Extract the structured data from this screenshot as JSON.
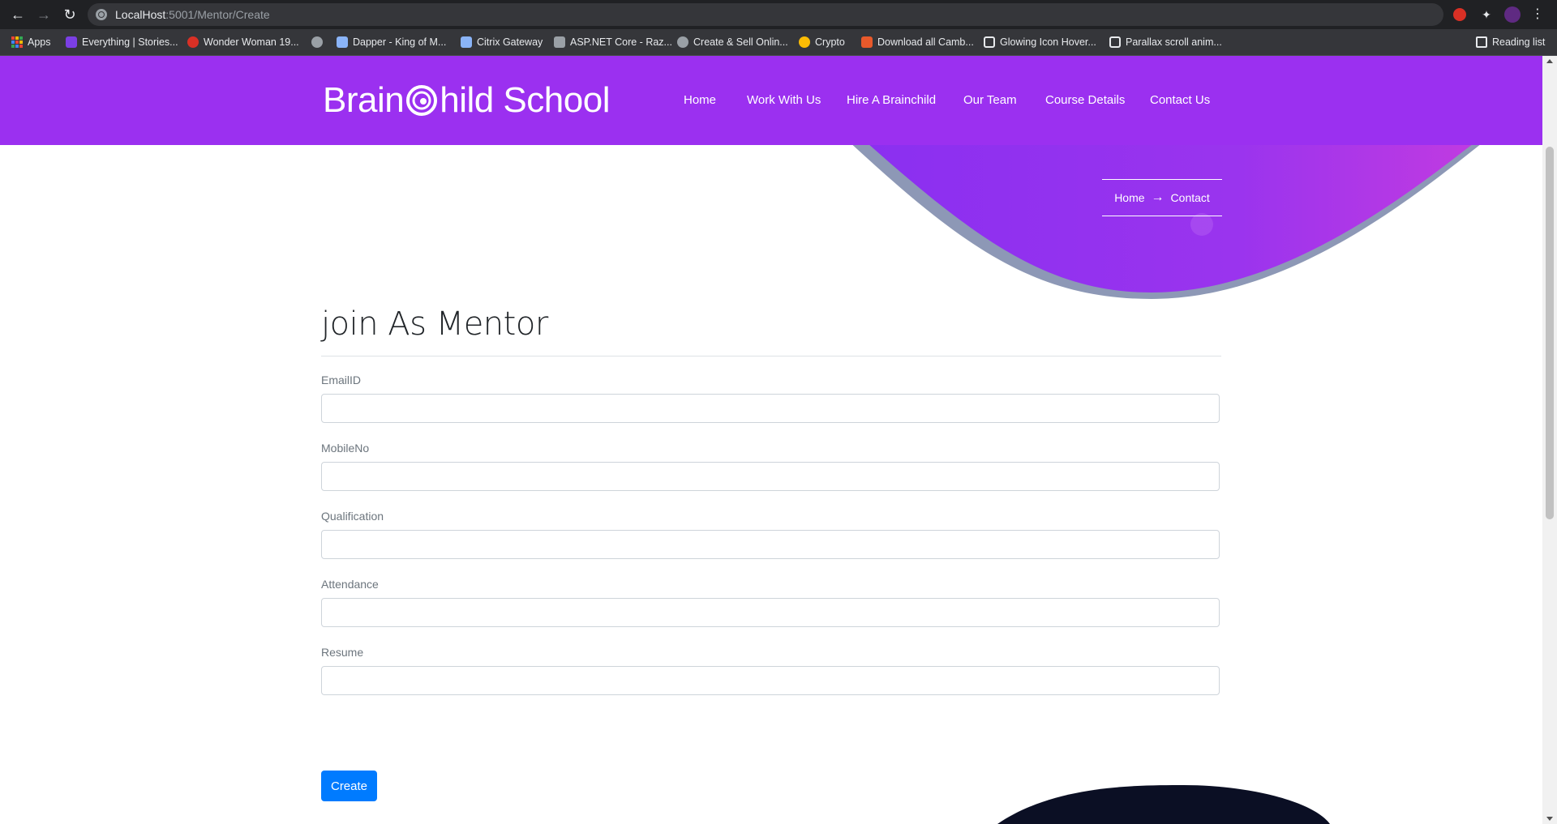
{
  "browser": {
    "url_host": "LocalHost",
    "url_rest": ":5001/Mentor/Create",
    "bookmarks": [
      {
        "label": "Apps",
        "icon": "apps-grid-icon",
        "color": "#4285f4"
      },
      {
        "label": "Everything | Stories...",
        "icon": "stories-icon",
        "color": "#7b3fe4"
      },
      {
        "label": "Wonder Woman 19...",
        "icon": "wonder-woman-icon",
        "color": "#d93025"
      },
      {
        "label": "",
        "icon": "globe-icon",
        "color": "#9aa0a6"
      },
      {
        "label": "Dapper - King of M...",
        "icon": "dapper-icon",
        "color": "#8ab4f8"
      },
      {
        "label": "Citrix Gateway",
        "icon": "citrix-icon",
        "color": "#8ab4f8"
      },
      {
        "label": "ASP.NET Core - Raz...",
        "icon": "aspnet-icon",
        "color": "#9aa0a6"
      },
      {
        "label": "Create & Sell Onlin...",
        "icon": "globe-icon",
        "color": "#9aa0a6"
      },
      {
        "label": "Crypto",
        "icon": "crypto-icon",
        "color": "#fbbc04"
      },
      {
        "label": "Download all Camb...",
        "icon": "download-icon",
        "color": "#e8592b"
      },
      {
        "label": "Glowing Icon Hover...",
        "icon": "codepen-icon",
        "color": "#e8eaed"
      },
      {
        "label": "Parallax scroll anim...",
        "icon": "codepen-icon",
        "color": "#e8eaed"
      }
    ],
    "reading_list": "Reading list"
  },
  "site": {
    "logo_text_1": "Brain",
    "logo_text_2": "hild School",
    "nav": [
      "Home",
      "Work With Us",
      "Hire A Brainchild",
      "Our Team",
      "Course Details",
      "Contact Us"
    ],
    "breadcrumb": {
      "home": "Home",
      "current": "Contact"
    },
    "brand_color": "#9b30f0"
  },
  "form": {
    "title": "join As Mentor",
    "fields": [
      {
        "label": "EmailID",
        "value": ""
      },
      {
        "label": "MobileNo",
        "value": ""
      },
      {
        "label": "Qualification",
        "value": ""
      },
      {
        "label": "Attendance",
        "value": ""
      },
      {
        "label": "Resume",
        "value": ""
      }
    ],
    "submit_label": "Create",
    "submit_color": "#007bff"
  }
}
